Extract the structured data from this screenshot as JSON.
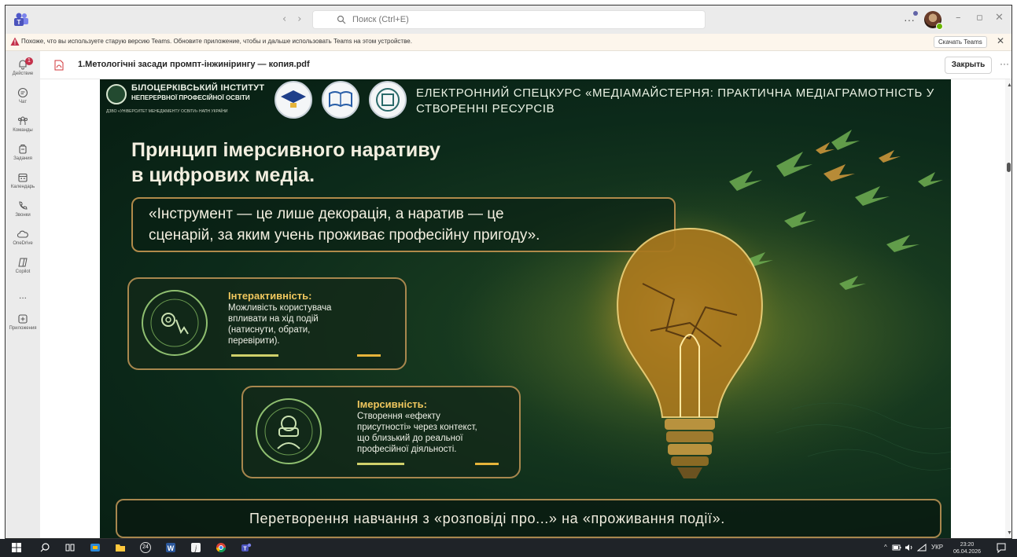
{
  "titlebar": {
    "search_placeholder": "Поиск (Ctrl+E)"
  },
  "banner": {
    "message": "Похоже, что вы используете старую версию Teams. Обновите приложение, чтобы и дальше использовать Teams на этом устройстве.",
    "download_label": "Скачать Teams"
  },
  "rail": {
    "items": [
      {
        "label": "Действие",
        "icon": "bell-icon",
        "badge": "1"
      },
      {
        "label": "Чат",
        "icon": "chat-icon"
      },
      {
        "label": "Команды",
        "icon": "teams-icon"
      },
      {
        "label": "Задания",
        "icon": "assignments-icon"
      },
      {
        "label": "Календарь",
        "icon": "calendar-icon"
      },
      {
        "label": "Звонки",
        "icon": "phone-icon"
      },
      {
        "label": "OneDrive",
        "icon": "onedrive-icon"
      },
      {
        "label": "Copilot",
        "icon": "copilot-icon"
      },
      {
        "label": "...",
        "icon": "more-icon"
      },
      {
        "label": "Приложения",
        "icon": "apps-icon"
      }
    ]
  },
  "file": {
    "title": "1.Метологічні засади промпт-інжинірингу — копия.pdf",
    "close_label": "Закрыть"
  },
  "slide": {
    "institute_name": "БІЛОЦЕРКІВСЬКИЙ ІНСТИТУТ",
    "institute_sub": "НЕПЕРЕРВНОЇ ПРОФЕСІЙНОЇ ОСВІТИ",
    "institute_dzvo": "ДЗВО «УНІВЕРСИТЕТ МЕНЕДЖМЕНТУ ОСВІТИ» НАПН УКРАЇНИ",
    "course_title": "ЕЛЕКТРОННИЙ СПЕЦКУРС «МЕДІАМАЙСТЕРНЯ: ПРАКТИЧНА МЕДІАГРАМОТНІСТЬ У СТВОРЕННІ РЕСУРСІВ",
    "title_line1": "Принцип імерсивного наративу",
    "title_line2": "в цифрових медіа.",
    "quote_line1": "«Інструмент — це лише декорація, а наратив — це",
    "quote_line2": "сценарій, за яким учень проживає професійну пригоду».",
    "card1_title": "Інтерактивність:",
    "card1_text": [
      "Можливість користувача",
      "впливати на хід подій",
      "(натиснути, обрати,",
      "перевірити)."
    ],
    "card2_title": "Імерсивність:",
    "card2_text": [
      "Створення «ефекту",
      "присутності» через контекст,",
      "що близький до реальної",
      "професійної діяльності."
    ],
    "footer": "Перетворення навчання з «розповіді про...» на «проживання події»."
  },
  "taskbar": {
    "badge_count": "24",
    "language": "УКР",
    "time": "23:20",
    "date": "06.04.2026"
  },
  "colors": {
    "accent_gold": "#f0c75e",
    "slide_bg": "#0c2a1a",
    "notification_red": "#c4314b",
    "teams_purple": "#6264a7"
  }
}
